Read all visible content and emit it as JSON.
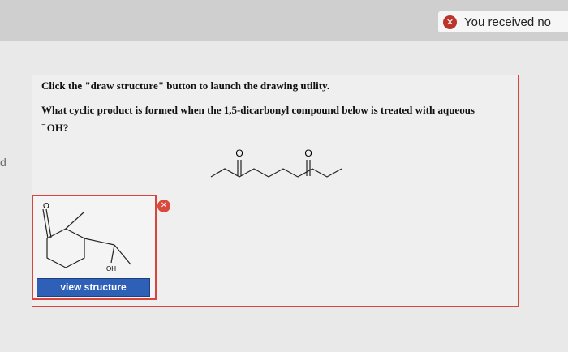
{
  "notification": {
    "text": "You received no",
    "icon": "close-icon"
  },
  "sidebar_fragment": "d",
  "question": {
    "instruction": "Click the \"draw structure\" button to launch the drawing utility.",
    "text_prefix": "What cyclic product is formed when the 1,5-dicarbonyl compound below is treated with aqueous",
    "reagent_charge": "−",
    "reagent": "OH?"
  },
  "given_structure": {
    "o1": "O",
    "o2": "O"
  },
  "answer": {
    "oh_label": "OH",
    "o_label": "O",
    "button_label": "view structure",
    "remove_icon": "close-icon"
  },
  "colors": {
    "accent_red": "#d6463d",
    "button_blue": "#2d60b6"
  }
}
